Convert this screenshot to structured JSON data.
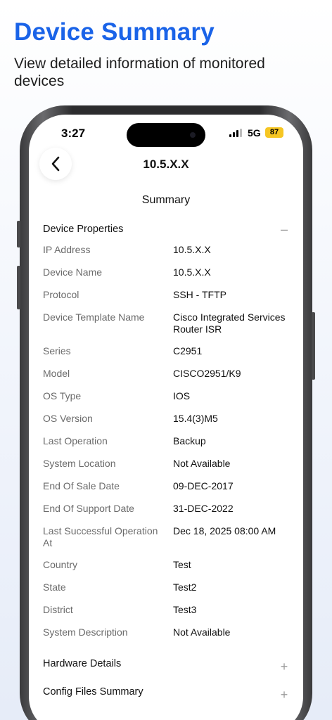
{
  "promo": {
    "title": "Device Summary",
    "subtitle": "View detailed information of monitored devices"
  },
  "status_bar": {
    "time": "3:27",
    "network": "5G",
    "battery": "87"
  },
  "header": {
    "title": "10.5.X.X",
    "back_icon": "chevron-left-icon"
  },
  "summary_label": "Summary",
  "sections": {
    "device_properties": {
      "label": "Device Properties",
      "toggle": "–",
      "expanded": true
    },
    "hardware_details": {
      "label": "Hardware Details",
      "toggle": "+",
      "expanded": false
    },
    "config_files": {
      "label": "Config Files Summary",
      "toggle": "+",
      "expanded": false
    }
  },
  "properties": [
    {
      "label": "IP Address",
      "value": "10.5.X.X"
    },
    {
      "label": "Device Name",
      "value": "10.5.X.X"
    },
    {
      "label": "Protocol",
      "value": "SSH - TFTP"
    },
    {
      "label": "Device Template Name",
      "value": "Cisco Integrated Services Router ISR"
    },
    {
      "label": "Series",
      "value": "C2951"
    },
    {
      "label": "Model",
      "value": "CISCO2951/K9"
    },
    {
      "label": "OS Type",
      "value": "IOS"
    },
    {
      "label": "OS Version",
      "value": "15.4(3)M5"
    },
    {
      "label": "Last Operation",
      "value": "Backup"
    },
    {
      "label": "System Location",
      "value": "Not Available"
    },
    {
      "label": "End Of Sale Date",
      "value": "09-DEC-2017"
    },
    {
      "label": "End Of Support Date",
      "value": "31-DEC-2022"
    },
    {
      "label": "Last Successful Operation At",
      "value": "Dec 18, 2025 08:00 AM"
    },
    {
      "label": "Country",
      "value": "Test"
    },
    {
      "label": "State",
      "value": "Test2"
    },
    {
      "label": "District",
      "value": "Test3"
    },
    {
      "label": "System Description",
      "value": "Not Available"
    }
  ],
  "colors": {
    "accent": "#1a63e8",
    "battery": "#f6c623"
  }
}
